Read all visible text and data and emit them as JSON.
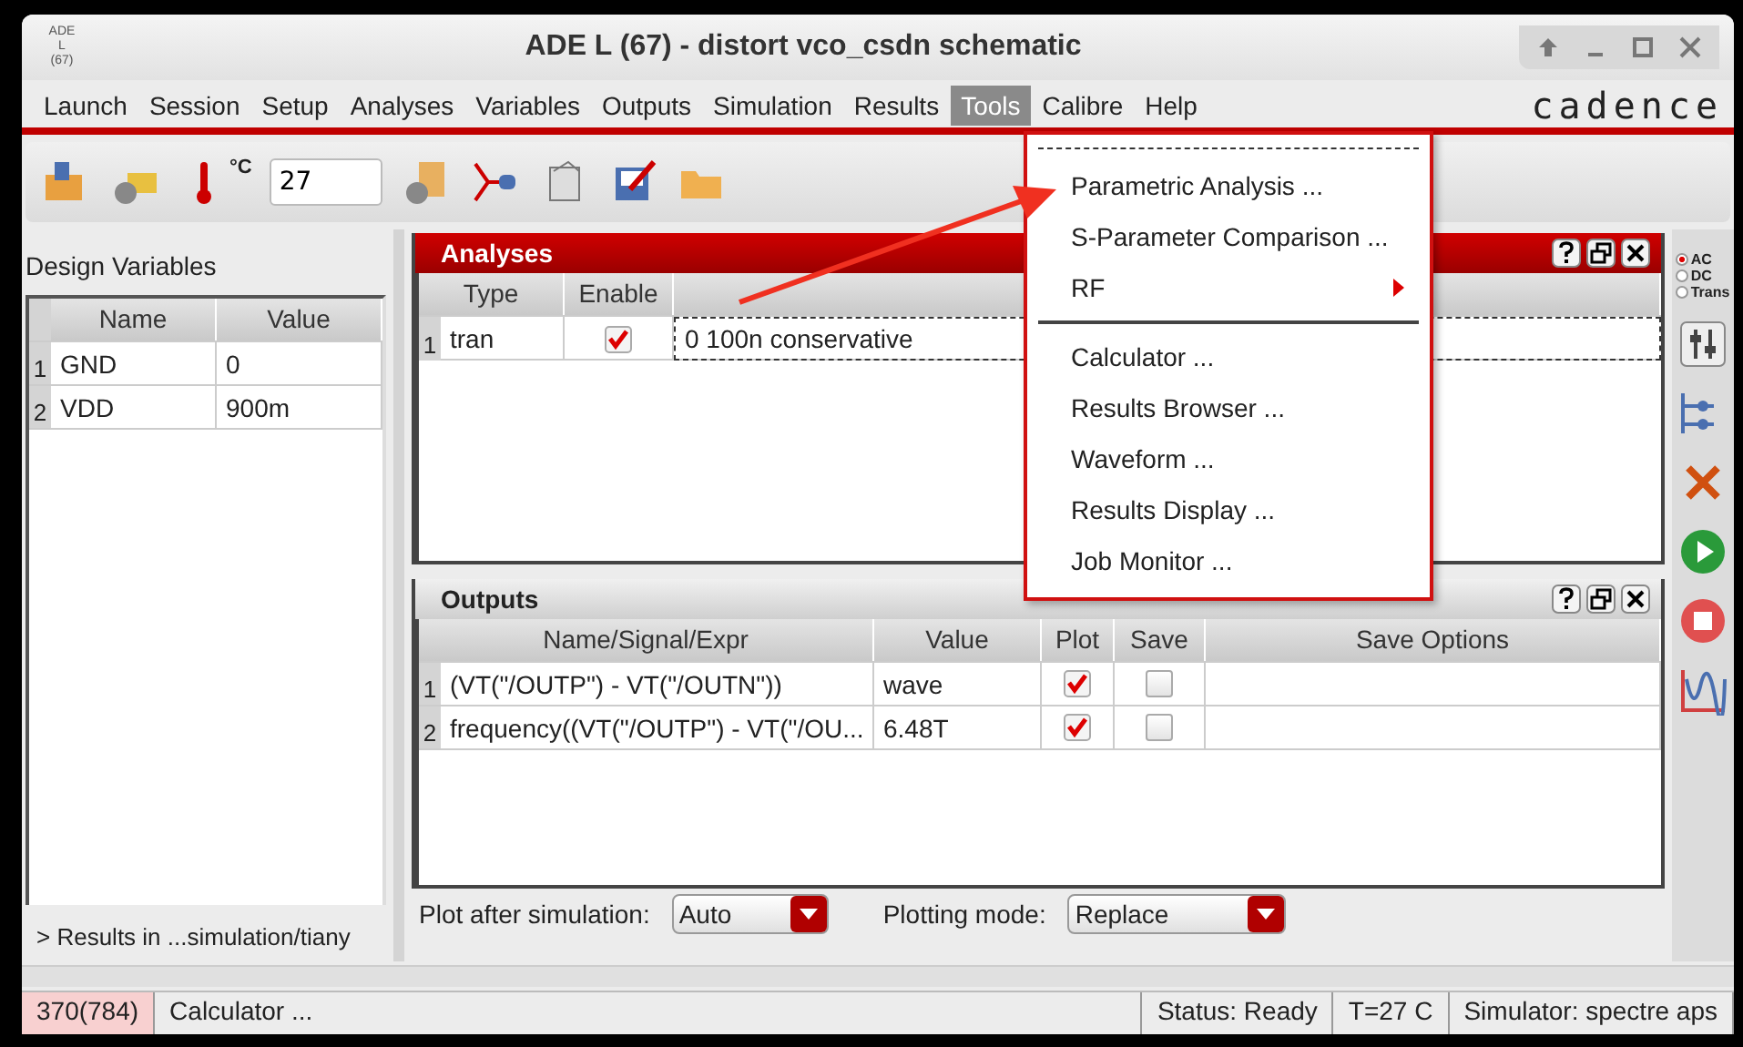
{
  "window": {
    "title": "ADE L (67) - distort vco_csdn schematic",
    "app_icon": [
      "ADE",
      "L",
      "(67)"
    ]
  },
  "menubar": {
    "items": [
      {
        "label": "Launch",
        "selected": false
      },
      {
        "label": "Session",
        "selected": false
      },
      {
        "label": "Setup",
        "selected": false
      },
      {
        "label": "Analyses",
        "selected": false
      },
      {
        "label": "Variables",
        "selected": false
      },
      {
        "label": "Outputs",
        "selected": false
      },
      {
        "label": "Simulation",
        "selected": false
      },
      {
        "label": "Results",
        "selected": false
      },
      {
        "label": "Tools",
        "selected": true
      },
      {
        "label": "Calibre",
        "selected": false
      },
      {
        "label": "Help",
        "selected": false
      }
    ],
    "logo": "cadence"
  },
  "toolbar": {
    "temperature_unit": "°C",
    "temperature": "27"
  },
  "tools_menu": {
    "items": [
      {
        "kind": "item",
        "label": "Parametric Analysis ..."
      },
      {
        "kind": "item",
        "label": "S-Parameter Comparison ..."
      },
      {
        "kind": "submenu",
        "label": "RF"
      },
      {
        "kind": "separator"
      },
      {
        "kind": "item",
        "label": "Calculator ..."
      },
      {
        "kind": "item",
        "label": "Results Browser ..."
      },
      {
        "kind": "item",
        "label": "Waveform ..."
      },
      {
        "kind": "item",
        "label": "Results Display ..."
      },
      {
        "kind": "item",
        "label": "Job Monitor ..."
      }
    ]
  },
  "design_variables": {
    "title": "Design Variables",
    "columns": [
      "Name",
      "Value"
    ],
    "rows": [
      {
        "index": "1",
        "name": "GND",
        "value": "0"
      },
      {
        "index": "2",
        "name": "VDD",
        "value": "900m"
      }
    ],
    "results_path": "> Results in ...simulation/tiany"
  },
  "analyses": {
    "title": "Analyses",
    "active": true,
    "columns": [
      "Type",
      "Enable"
    ],
    "rows": [
      {
        "index": "1",
        "type": "tran",
        "enabled": true,
        "arguments": "0 100n conservative"
      }
    ]
  },
  "outputs": {
    "title": "Outputs",
    "active": false,
    "columns": [
      "Name/Signal/Expr",
      "Value",
      "Plot",
      "Save",
      "Save Options"
    ],
    "rows": [
      {
        "index": "1",
        "expr": "(VT(\"/OUTP\") - VT(\"/OUTN\"))",
        "value": "wave",
        "plot": true,
        "save": false
      },
      {
        "index": "2",
        "expr": "frequency((VT(\"/OUTP\") - VT(\"/OU...",
        "value": "6.48T",
        "plot": true,
        "save": false
      }
    ]
  },
  "plot_options": {
    "plot_after_label": "Plot after simulation:",
    "plot_after": "Auto",
    "mode_label": "Plotting mode:",
    "mode": "Replace"
  },
  "analysis_types": [
    {
      "label": "AC",
      "selected": true
    },
    {
      "label": "DC",
      "selected": false
    },
    {
      "label": "Trans",
      "selected": false
    }
  ],
  "status_bar": {
    "position": "370(784)",
    "message": "Calculator ...",
    "status": "Status: Ready",
    "temperature": "T=27 C",
    "simulator": "Simulator: spectre aps"
  }
}
